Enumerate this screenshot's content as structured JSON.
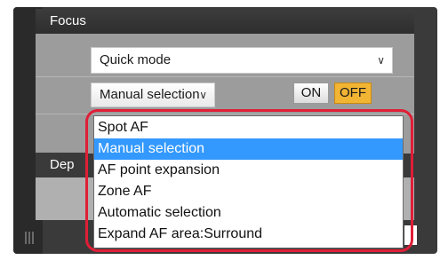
{
  "panel": {
    "section_title": "Focus",
    "quick_select_value": "Quick mode",
    "manual_select_value": "Manual selection",
    "on_label": "ON",
    "off_label": "OFF",
    "depth_title_partial": "Dep"
  },
  "dropdown": {
    "options": [
      "Spot AF",
      "Manual selection",
      "AF point expansion",
      "Zone AF",
      "Automatic selection",
      "Expand AF area:Surround"
    ],
    "selected_index": 1
  },
  "colors": {
    "selected_option": "#3399ff",
    "off_active": "#f2b433",
    "highlight_outline": "#e01e37"
  },
  "icons": {
    "dropdown_arrow": "chevron-down-icon",
    "panel_grip": "drag-grip-icon"
  }
}
